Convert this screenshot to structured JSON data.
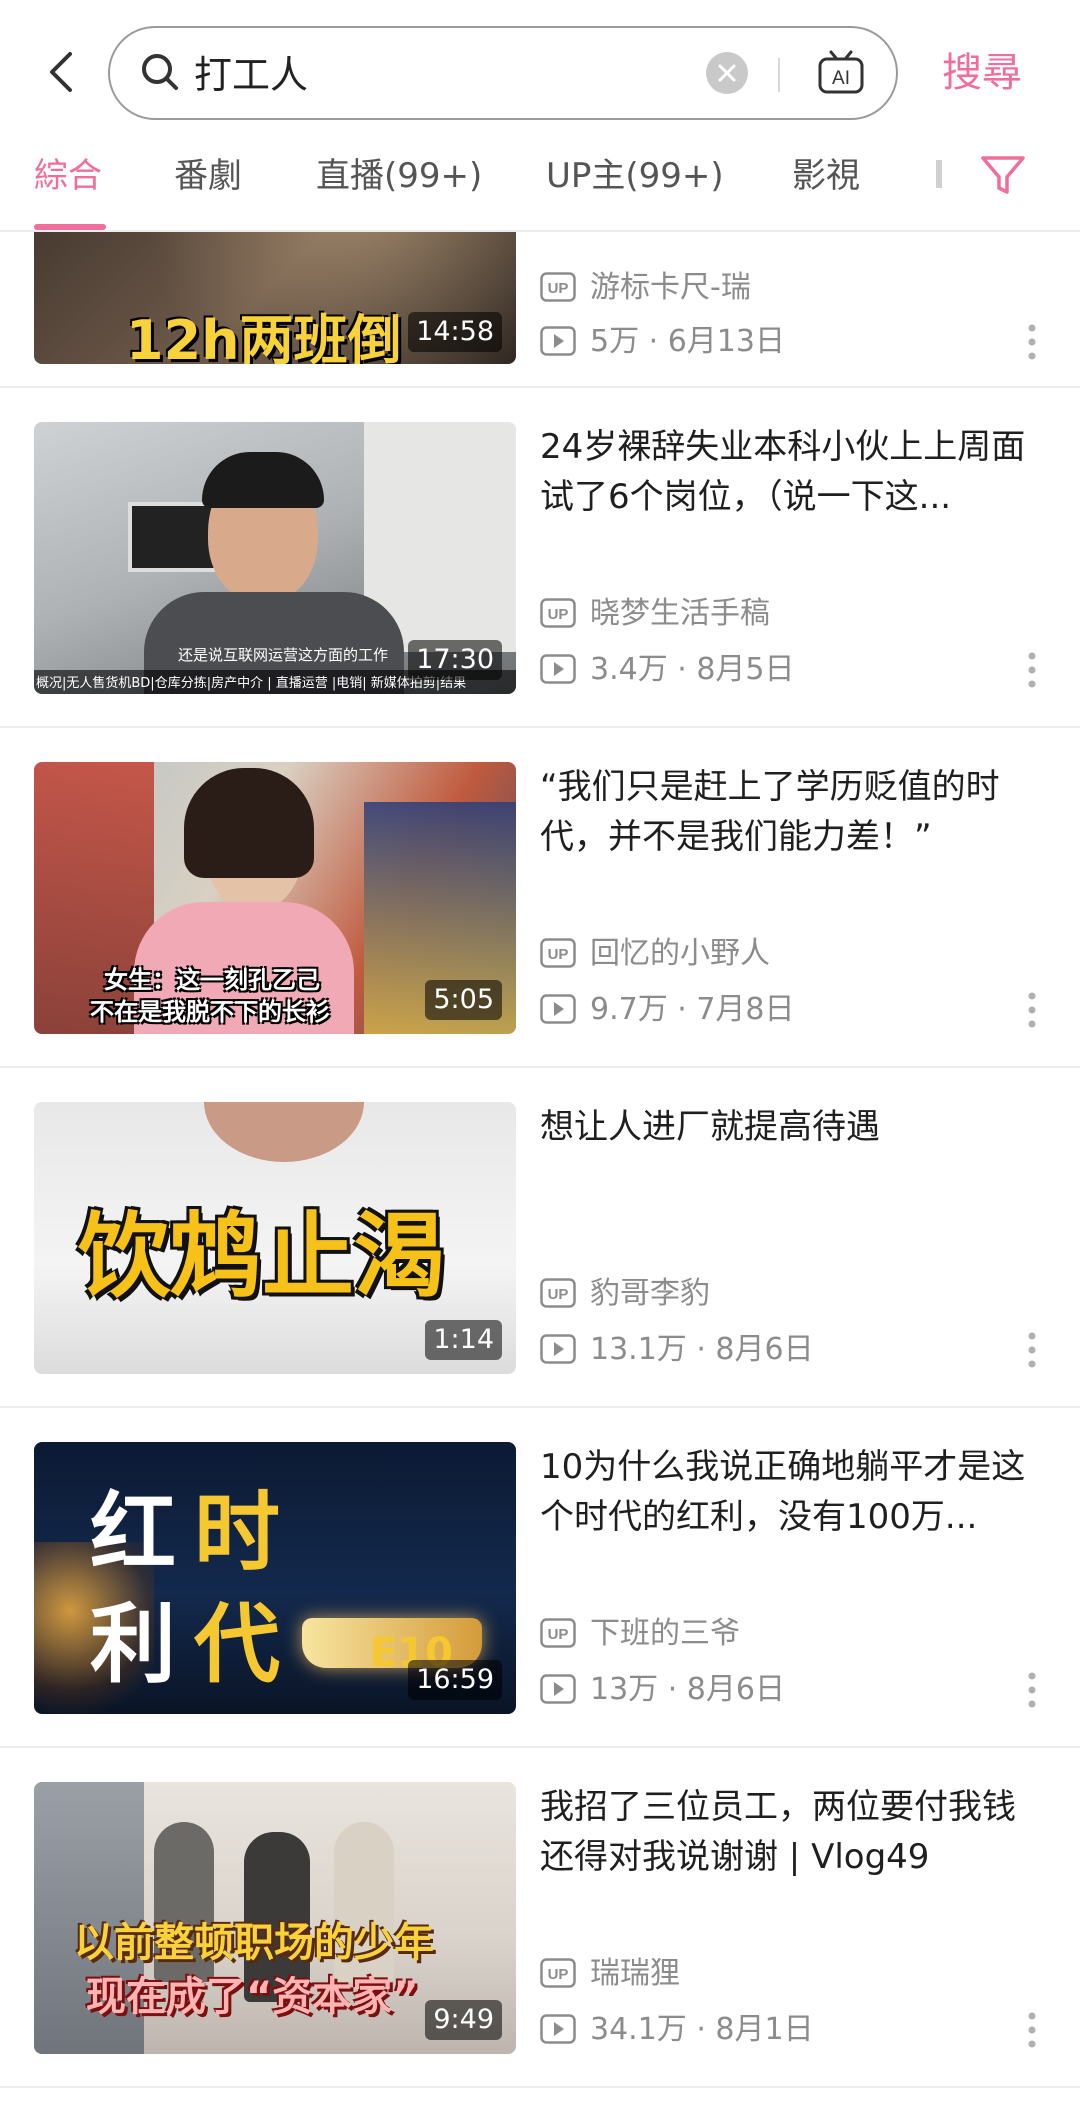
{
  "search": {
    "query": "打工人",
    "submit_label": "搜尋"
  },
  "tabs": [
    {
      "label": "綜合",
      "active": true
    },
    {
      "label": "番劇",
      "active": false
    },
    {
      "label": "直播(99+)",
      "active": false
    },
    {
      "label": "UP主(99+)",
      "active": false
    },
    {
      "label": "影視",
      "active": false
    }
  ],
  "colors": {
    "accent": "#f06e9c",
    "meta_text": "#8c8c8c"
  },
  "videos": [
    {
      "title": "",
      "thumb_text": "12h两班倒",
      "duration": "14:58",
      "uploader": "游标卡尺-瑞",
      "views": "5万",
      "date": "6月13日"
    },
    {
      "title": "24岁裸辞失业本科小伙上上周面试了6个岗位，（说一下这...",
      "thumb_caption": "还是说互联网运营这方面的工作",
      "thumb_ticker": "概况|无人售货机BD|仓库分拣|房产中介 | 直播运营 |电销| 新媒体拍剪|结果",
      "duration": "17:30",
      "uploader": "晓梦生活手稿",
      "views": "3.4万",
      "date": "8月5日"
    },
    {
      "title": "“我们只是赶上了学历贬值的时代，并不是我们能力差！”",
      "thumb_caption_1": "女生：这一刻孔乙己",
      "thumb_caption_2": "不在是我脱不下的长衫",
      "duration": "5:05",
      "uploader": "回忆的小野人",
      "views": "9.7万",
      "date": "7月8日"
    },
    {
      "title": "想让人进厂就提高待遇",
      "thumb_text": "饮鸩止渴",
      "duration": "1:14",
      "uploader": "豹哥李豹",
      "views": "13.1万",
      "date": "8月6日"
    },
    {
      "title": "10为什么我说正确地躺平才是这个时代的红利，没有100万...",
      "thumb_text_1": "红",
      "thumb_text_2": "时",
      "thumb_text_3": "利",
      "thumb_text_4": "代",
      "thumb_episode": "E10",
      "duration": "16:59",
      "uploader": "下班的三爷",
      "views": "13万",
      "date": "8月6日"
    },
    {
      "title": "我招了三位员工，两位要付我钱还得对我说谢谢 | Vlog49",
      "thumb_caption_1": "以前整顿职场的少年",
      "thumb_caption_2": "现在成了“资本家”",
      "duration": "9:49",
      "uploader": "瑞瑞狸",
      "views": "34.1万",
      "date": "8月1日"
    }
  ]
}
